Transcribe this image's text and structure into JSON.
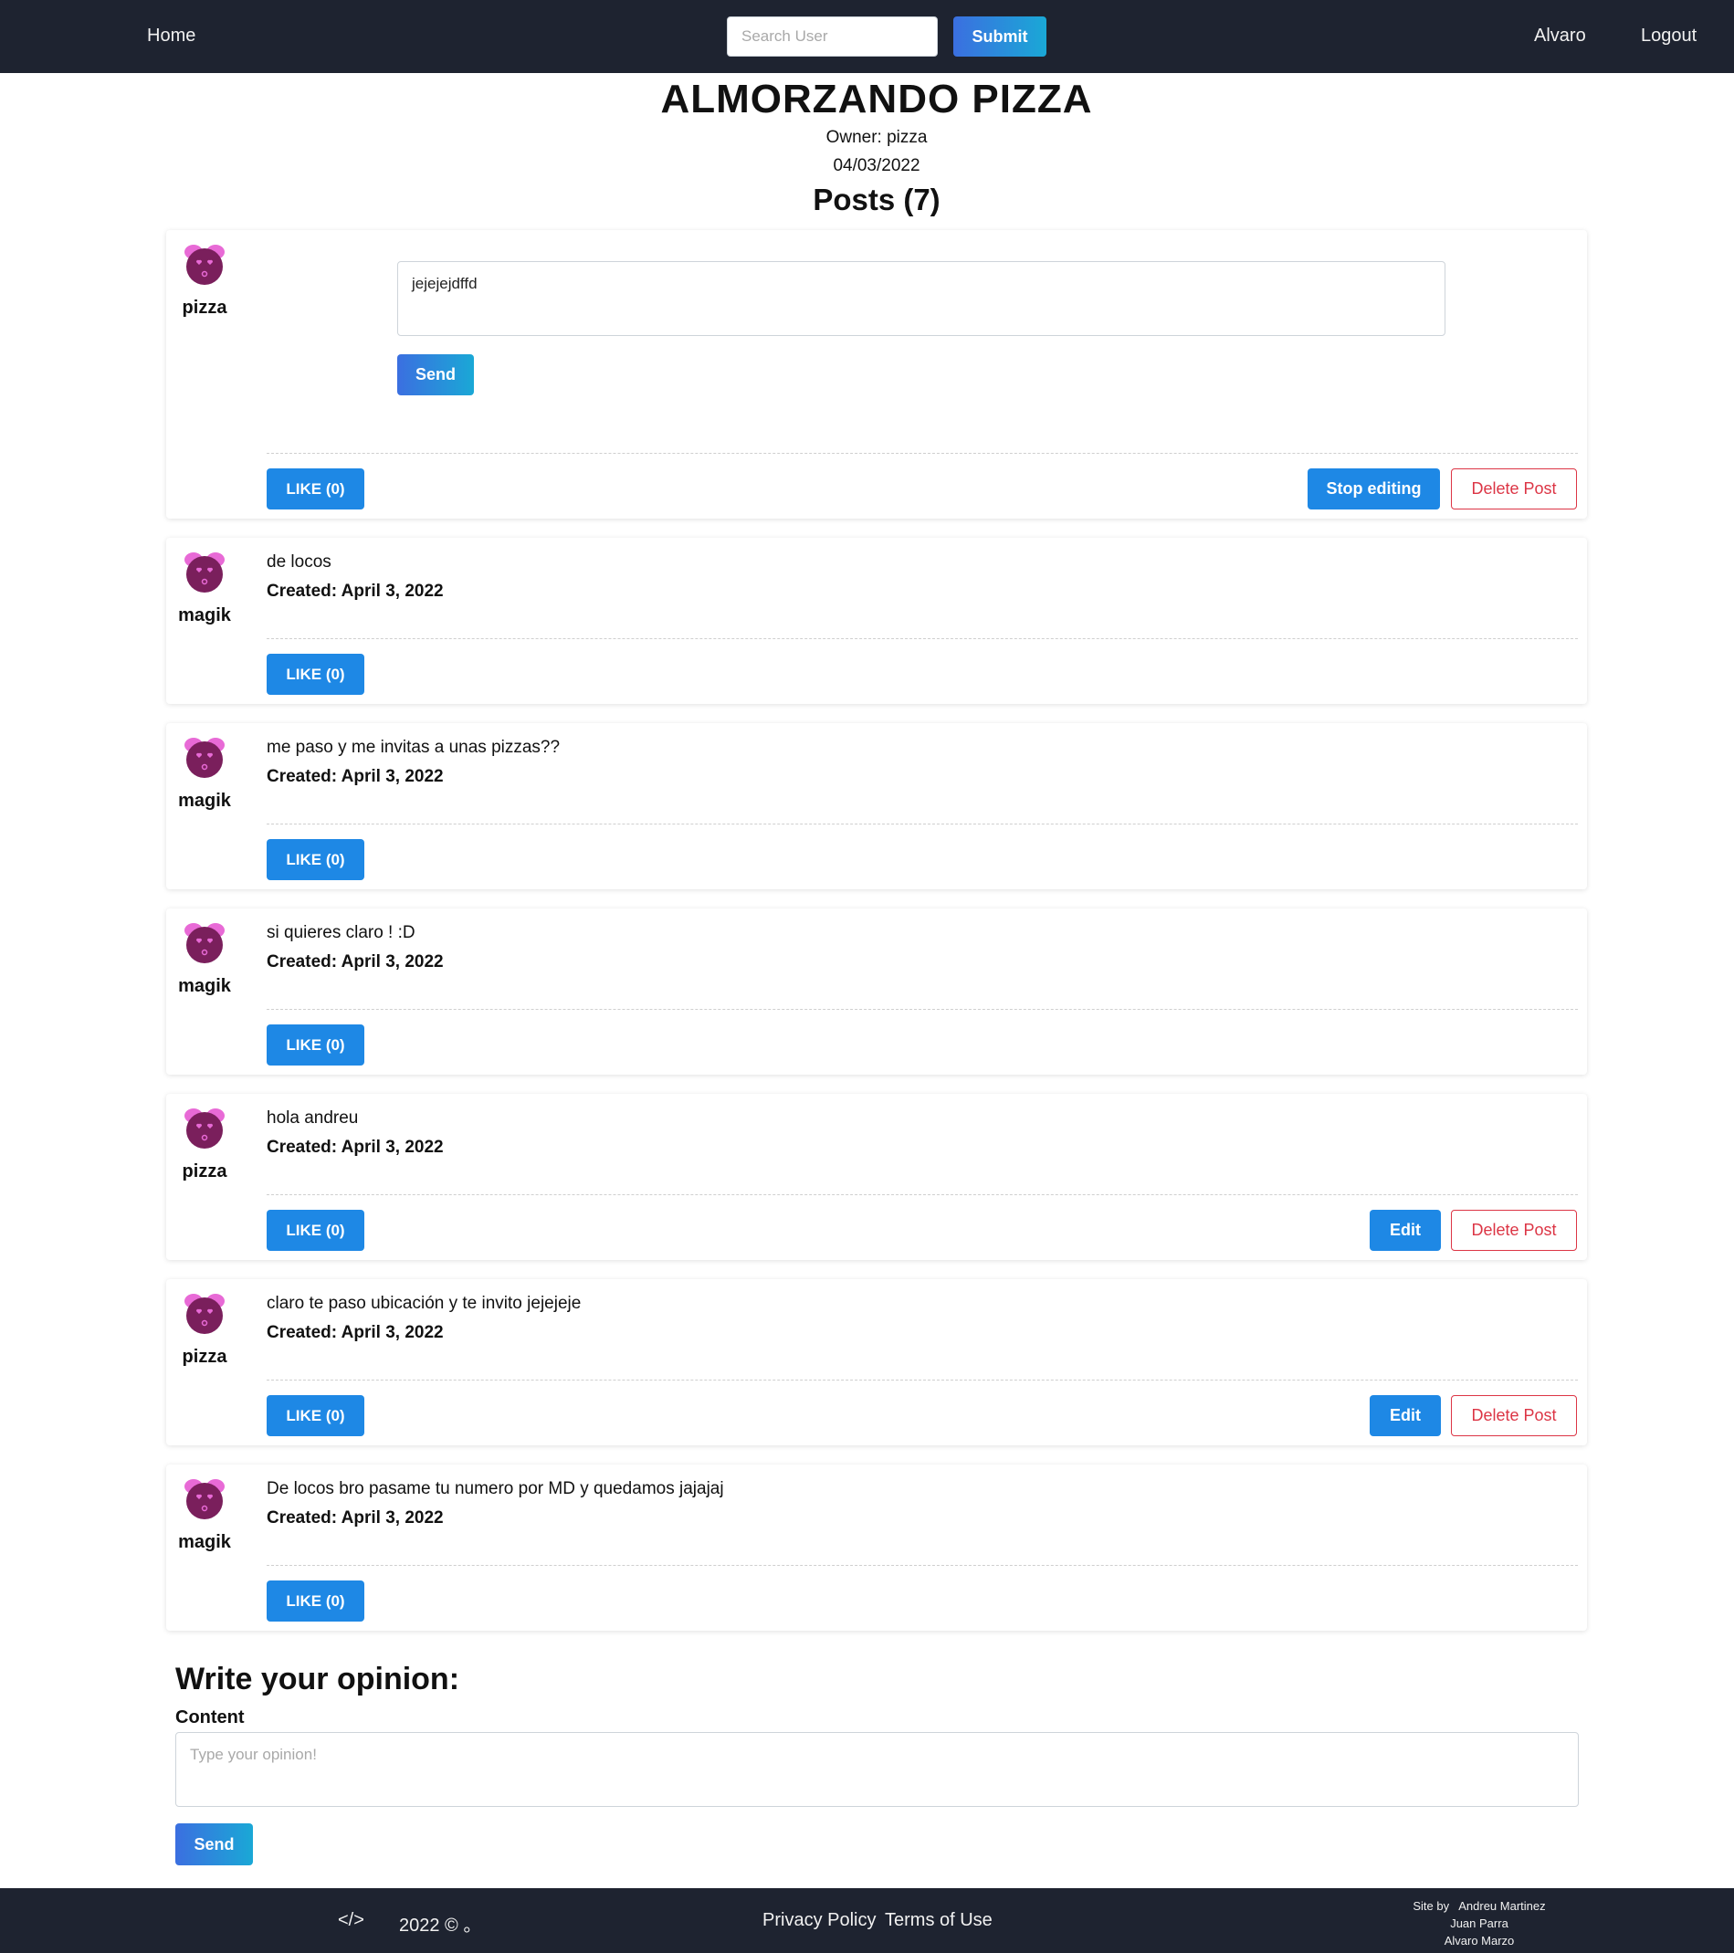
{
  "navbar": {
    "home": "Home",
    "search_placeholder": "Search User",
    "submit": "Submit",
    "user": "Alvaro",
    "logout": "Logout"
  },
  "header": {
    "title": "ALMORZANDO PIZZA",
    "owner": "Owner: pizza",
    "date": "04/03/2022",
    "posts_title": "Posts (7)"
  },
  "posts": [
    {
      "author": "pizza",
      "editing": true,
      "edit_value": "jejejejdffd",
      "send_label": "Send",
      "like_label": "LIKE (0)",
      "stop_edit_label": "Stop editing",
      "delete_label": "Delete Post"
    },
    {
      "author": "magik",
      "content": "de locos",
      "created": "Created: April 3, 2022",
      "like_label": "LIKE (0)"
    },
    {
      "author": "magik",
      "content": "me paso y me invitas a unas pizzas??",
      "created": "Created: April 3, 2022",
      "like_label": "LIKE (0)"
    },
    {
      "author": "magik",
      "content": "si quieres claro ! :D",
      "created": "Created: April 3, 2022",
      "like_label": "LIKE (0)"
    },
    {
      "author": "pizza",
      "content": "hola andreu",
      "created": "Created: April 3, 2022",
      "like_label": "LIKE (0)",
      "edit_label": "Edit",
      "delete_label": "Delete Post"
    },
    {
      "author": "pizza",
      "content": "claro te paso ubicación y te invito jejejeje",
      "created": "Created: April 3, 2022",
      "like_label": "LIKE (0)",
      "edit_label": "Edit",
      "delete_label": "Delete Post"
    },
    {
      "author": "magik",
      "content": "De locos bro pasame tu numero por MD y quedamos jajajaj",
      "created": "Created: April 3, 2022",
      "like_label": "LIKE (0)"
    }
  ],
  "opinion": {
    "title": "Write your opinion:",
    "content_label": "Content",
    "placeholder": "Type your opinion!",
    "send": "Send"
  },
  "footer": {
    "code_icon": "</>",
    "copyright": "2022 © 。",
    "privacy": "Privacy Policy",
    "terms": "Terms of Use",
    "credits_line1": "Site by   Andreu Martinez",
    "credits_line2": "Juan Parra",
    "credits_line3": "Alvaro Marzo"
  },
  "colors": {
    "navbar_bg": "#1e2330",
    "primary": "#1e88e5",
    "danger": "#dc3545",
    "avatar_body": "#7a1f5c",
    "avatar_accent": "#e86ad6"
  },
  "icons": {
    "avatar": "avatar-icon",
    "code": "code-icon"
  }
}
